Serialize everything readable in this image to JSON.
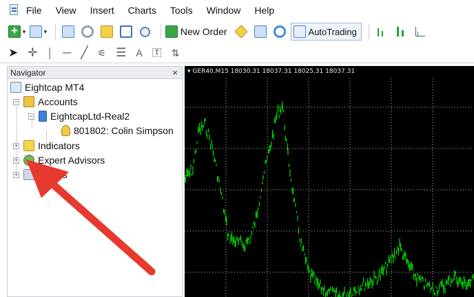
{
  "menubar": {
    "items": [
      "File",
      "View",
      "Insert",
      "Charts",
      "Tools",
      "Window",
      "Help"
    ]
  },
  "toolbar": {
    "new_order_label": "New Order",
    "autotrading_label": "AutoTrading"
  },
  "toolbar2": {
    "text_tool_label": "A"
  },
  "navigator": {
    "title": "Navigator",
    "close_label": "×",
    "root_label": "Eightcap MT4",
    "accounts_label": "Accounts",
    "server_label": "EightcapLtd-Real2",
    "account_label": "801802: Colin Simpson",
    "indicators_label": "Indicators",
    "experts_label": "Expert Advisors",
    "scripts_label": "Scripts"
  },
  "chart": {
    "header": "GER40,M15  18030.31 18037.31 18025.31 18037.31",
    "grid_color": "#bfbfbf",
    "candle_color": "#00e000",
    "background": "#000000"
  },
  "annotation": {
    "arrow_color": "#e63a2e"
  }
}
